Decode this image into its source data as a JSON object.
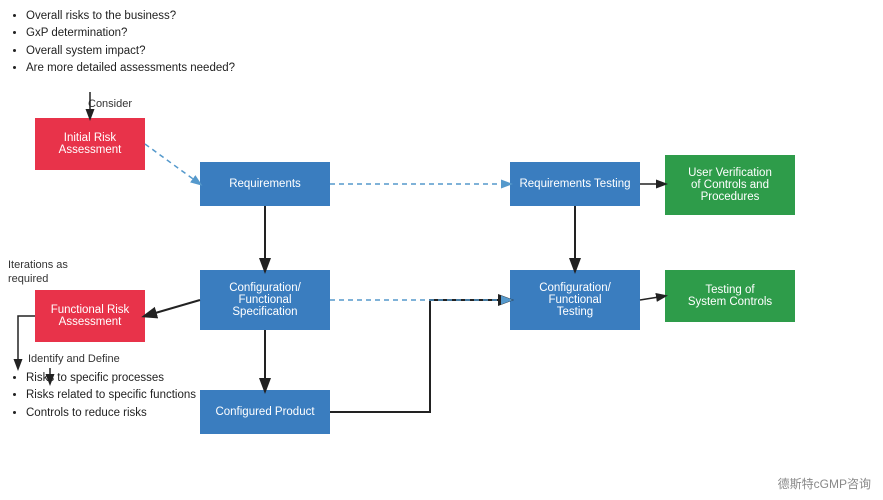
{
  "bullets_top": [
    "Overall risks to the business?",
    "GxP determination?",
    "Overall system impact?",
    "Are more detailed assessments needed?"
  ],
  "bullets_bottom": [
    "Risks to specific processes",
    "Risks related to specific functions",
    "Controls to reduce risks"
  ],
  "labels": {
    "consider": "Consider",
    "iterations": "Iterations as required",
    "identify": "Identify and Define"
  },
  "boxes": {
    "initial_risk": "Initial Risk\nAssessment",
    "functional_risk": "Functional Risk\nAssessment",
    "requirements": "Requirements",
    "config_spec": "Configuration/\nFunctional\nSpecification",
    "configured_product": "Configured\nProduct",
    "requirements_testing": "Requirements\nTesting",
    "config_testing": "Configuration/\nFunctional\nTesting",
    "user_verification": "User Verification\nof Controls and\nProcedures",
    "testing_controls": "Testing of\nSystem Controls"
  },
  "watermark": "德斯特cGMP咨询"
}
